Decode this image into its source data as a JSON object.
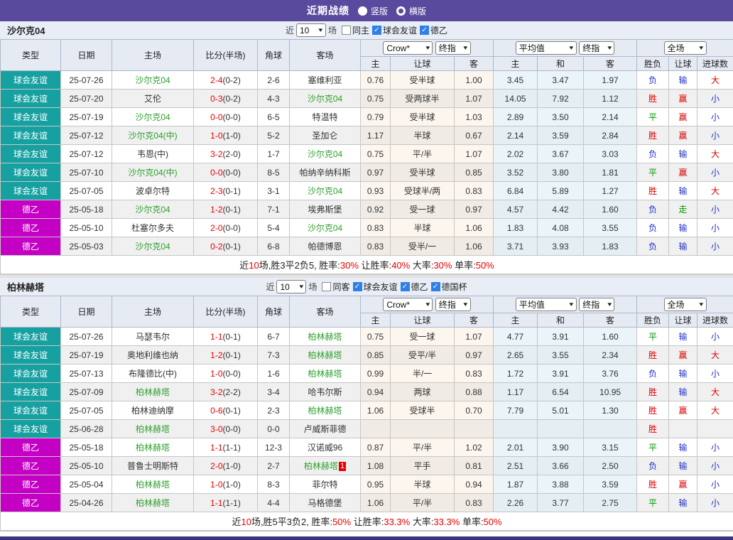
{
  "top": {
    "title": "近期战绩",
    "radio_vertical": "竖版",
    "radio_horizontal": "横版"
  },
  "controls": {
    "near": "近",
    "rounds": "10",
    "games": "场"
  },
  "selects": {
    "odds_source": "Crow*",
    "odds_time": "终指",
    "avg_source": "平均值",
    "avg_time": "终指",
    "scope": "全场"
  },
  "columns": {
    "type": "类型",
    "date": "日期",
    "home": "主场",
    "score": "比分(半场)",
    "corner": "角球",
    "away": "客场",
    "h": "主",
    "hcap": "让球",
    "a": "客",
    "avg_h": "主",
    "avg_d": "和",
    "avg_a": "客",
    "wdl": "胜负",
    "hcap_res": "让球",
    "goals": "进球数"
  },
  "result_colors": {
    "胜": "red",
    "平": "green",
    "负": "blue",
    "赢": "red",
    "输": "blue",
    "走": "green",
    "大": "red",
    "小": "blue"
  },
  "league_colors": {
    "球会友谊": "teal",
    "德乙": "magenta"
  },
  "sections": [
    {
      "team": "沙尔克04",
      "filters": [
        {
          "label": "同主",
          "checked": false
        },
        {
          "label": "球会友谊",
          "checked": true
        },
        {
          "label": "德乙",
          "checked": true
        }
      ],
      "rows": [
        {
          "league": "球会友谊",
          "date": "25-07-26",
          "home": "沙尔克04",
          "home_self": true,
          "score": "2-4",
          "half": "(0-2)",
          "corner": "2-6",
          "away": "塞维利亚",
          "away_self": false,
          "away_badge": "",
          "odds": [
            "0.76",
            "受半球",
            "1.00"
          ],
          "avg": [
            "3.45",
            "3.47",
            "1.97"
          ],
          "res": [
            "负",
            "输",
            "大"
          ]
        },
        {
          "league": "球会友谊",
          "date": "25-07-20",
          "home": "艾伦",
          "home_self": false,
          "score": "0-3",
          "half": "(0-2)",
          "corner": "4-3",
          "away": "沙尔克04",
          "away_self": true,
          "away_badge": "",
          "odds": [
            "0.75",
            "受两球半",
            "1.07"
          ],
          "avg": [
            "14.05",
            "7.92",
            "1.12"
          ],
          "res": [
            "胜",
            "赢",
            "小"
          ]
        },
        {
          "league": "球会友谊",
          "date": "25-07-19",
          "home": "沙尔克04",
          "home_self": true,
          "score": "0-0",
          "half": "(0-0)",
          "corner": "6-5",
          "away": "特温特",
          "away_self": false,
          "away_badge": "",
          "odds": [
            "0.79",
            "受半球",
            "1.03"
          ],
          "avg": [
            "2.89",
            "3.50",
            "2.14"
          ],
          "res": [
            "平",
            "赢",
            "小"
          ]
        },
        {
          "league": "球会友谊",
          "date": "25-07-12",
          "home": "沙尔克04(中)",
          "home_self": true,
          "score": "1-0",
          "half": "(1-0)",
          "corner": "5-2",
          "away": "圣加仑",
          "away_self": false,
          "away_badge": "",
          "odds": [
            "1.17",
            "半球",
            "0.67"
          ],
          "avg": [
            "2.14",
            "3.59",
            "2.84"
          ],
          "res": [
            "胜",
            "赢",
            "小"
          ]
        },
        {
          "league": "球会友谊",
          "date": "25-07-12",
          "home": "韦恩(中)",
          "home_self": false,
          "score": "3-2",
          "half": "(2-0)",
          "corner": "1-7",
          "away": "沙尔克04",
          "away_self": true,
          "away_badge": "",
          "odds": [
            "0.75",
            "平/半",
            "1.07"
          ],
          "avg": [
            "2.02",
            "3.67",
            "3.03"
          ],
          "res": [
            "负",
            "输",
            "大"
          ]
        },
        {
          "league": "球会友谊",
          "date": "25-07-10",
          "home": "沙尔克04(中)",
          "home_self": true,
          "score": "0-0",
          "half": "(0-0)",
          "corner": "8-5",
          "away": "帕纳辛纳科斯",
          "away_self": false,
          "away_badge": "",
          "odds": [
            "0.97",
            "受半球",
            "0.85"
          ],
          "avg": [
            "3.52",
            "3.80",
            "1.81"
          ],
          "res": [
            "平",
            "赢",
            "小"
          ]
        },
        {
          "league": "球会友谊",
          "date": "25-07-05",
          "home": "波卓尔特",
          "home_self": false,
          "score": "2-3",
          "half": "(0-1)",
          "corner": "3-1",
          "away": "沙尔克04",
          "away_self": true,
          "away_badge": "",
          "odds": [
            "0.93",
            "受球半/两",
            "0.83"
          ],
          "avg": [
            "6.84",
            "5.89",
            "1.27"
          ],
          "res": [
            "胜",
            "输",
            "大"
          ]
        },
        {
          "league": "德乙",
          "date": "25-05-18",
          "home": "沙尔克04",
          "home_self": true,
          "score": "1-2",
          "half": "(0-1)",
          "corner": "7-1",
          "away": "埃弗斯堡",
          "away_self": false,
          "away_badge": "",
          "odds": [
            "0.92",
            "受一球",
            "0.97"
          ],
          "avg": [
            "4.57",
            "4.42",
            "1.60"
          ],
          "res": [
            "负",
            "走",
            "小"
          ]
        },
        {
          "league": "德乙",
          "date": "25-05-10",
          "home": "杜塞尔多夫",
          "home_self": false,
          "score": "2-0",
          "half": "(0-0)",
          "corner": "5-4",
          "away": "沙尔克04",
          "away_self": true,
          "away_badge": "",
          "odds": [
            "0.83",
            "半球",
            "1.06"
          ],
          "avg": [
            "1.83",
            "4.08",
            "3.55"
          ],
          "res": [
            "负",
            "输",
            "小"
          ]
        },
        {
          "league": "德乙",
          "date": "25-05-03",
          "home": "沙尔克04",
          "home_self": true,
          "score": "0-2",
          "half": "(0-1)",
          "corner": "6-8",
          "away": "帕德博恩",
          "away_self": false,
          "away_badge": "",
          "odds": [
            "0.83",
            "受半/一",
            "1.06"
          ],
          "avg": [
            "3.71",
            "3.93",
            "1.83"
          ],
          "res": [
            "负",
            "输",
            "小"
          ]
        }
      ],
      "summary_parts": [
        {
          "t": "近"
        },
        {
          "t": "10",
          "red": true
        },
        {
          "t": "场,胜3平2负5, 胜率:"
        },
        {
          "t": "30%",
          "red": true
        },
        {
          "t": " 让胜率:"
        },
        {
          "t": "40%",
          "red": true
        },
        {
          "t": " 大率:"
        },
        {
          "t": "30%",
          "red": true
        },
        {
          "t": " 单率:"
        },
        {
          "t": "50%",
          "red": true
        }
      ]
    },
    {
      "team": "柏林赫塔",
      "filters": [
        {
          "label": "同客",
          "checked": false
        },
        {
          "label": "球会友谊",
          "checked": true
        },
        {
          "label": "德乙",
          "checked": true
        },
        {
          "label": "德国杯",
          "checked": true
        }
      ],
      "rows": [
        {
          "league": "球会友谊",
          "date": "25-07-26",
          "home": "马瑟韦尔",
          "home_self": false,
          "score": "1-1",
          "half": "(0-1)",
          "corner": "6-7",
          "away": "柏林赫塔",
          "away_self": true,
          "away_badge": "",
          "odds": [
            "0.75",
            "受一球",
            "1.07"
          ],
          "avg": [
            "4.77",
            "3.91",
            "1.60"
          ],
          "res": [
            "平",
            "输",
            "小"
          ]
        },
        {
          "league": "球会友谊",
          "date": "25-07-19",
          "home": "奥地利维也纳",
          "home_self": false,
          "score": "1-2",
          "half": "(0-1)",
          "corner": "7-3",
          "away": "柏林赫塔",
          "away_self": true,
          "away_badge": "",
          "odds": [
            "0.85",
            "受平/半",
            "0.97"
          ],
          "avg": [
            "2.65",
            "3.55",
            "2.34"
          ],
          "res": [
            "胜",
            "赢",
            "大"
          ]
        },
        {
          "league": "球会友谊",
          "date": "25-07-13",
          "home": "布隆德比(中)",
          "home_self": false,
          "score": "1-0",
          "half": "(0-0)",
          "corner": "1-6",
          "away": "柏林赫塔",
          "away_self": true,
          "away_badge": "",
          "odds": [
            "0.99",
            "半/一",
            "0.83"
          ],
          "avg": [
            "1.72",
            "3.91",
            "3.76"
          ],
          "res": [
            "负",
            "输",
            "小"
          ]
        },
        {
          "league": "球会友谊",
          "date": "25-07-09",
          "home": "柏林赫塔",
          "home_self": true,
          "score": "3-2",
          "half": "(2-2)",
          "corner": "3-4",
          "away": "哈韦尔斯",
          "away_self": false,
          "away_badge": "",
          "odds": [
            "0.94",
            "两球",
            "0.88"
          ],
          "avg": [
            "1.17",
            "6.54",
            "10.95"
          ],
          "res": [
            "胜",
            "输",
            "大"
          ]
        },
        {
          "league": "球会友谊",
          "date": "25-07-05",
          "home": "柏林迪纳摩",
          "home_self": false,
          "score": "0-6",
          "half": "(0-1)",
          "corner": "2-3",
          "away": "柏林赫塔",
          "away_self": true,
          "away_badge": "",
          "odds": [
            "1.06",
            "受球半",
            "0.70"
          ],
          "avg": [
            "7.79",
            "5.01",
            "1.30"
          ],
          "res": [
            "胜",
            "赢",
            "大"
          ]
        },
        {
          "league": "球会友谊",
          "date": "25-06-28",
          "home": "柏林赫塔",
          "home_self": true,
          "score": "3-0",
          "half": "(0-0)",
          "corner": "0-0",
          "away": "卢威斯菲德",
          "away_self": false,
          "away_badge": "",
          "odds": [
            "",
            "",
            ""
          ],
          "avg": [
            "",
            "",
            ""
          ],
          "res": [
            "胜",
            "",
            ""
          ]
        },
        {
          "league": "德乙",
          "date": "25-05-18",
          "home": "柏林赫塔",
          "home_self": true,
          "score": "1-1",
          "half": "(1-1)",
          "corner": "12-3",
          "away": "汉诺威96",
          "away_self": false,
          "away_badge": "",
          "odds": [
            "0.87",
            "平/半",
            "1.02"
          ],
          "avg": [
            "2.01",
            "3.90",
            "3.15"
          ],
          "res": [
            "平",
            "输",
            "小"
          ]
        },
        {
          "league": "德乙",
          "date": "25-05-10",
          "home": "普鲁士明斯特",
          "home_self": false,
          "score": "2-0",
          "half": "(1-0)",
          "corner": "2-7",
          "away": "柏林赫塔",
          "away_self": true,
          "away_badge": "1",
          "odds": [
            "1.08",
            "平手",
            "0.81"
          ],
          "avg": [
            "2.51",
            "3.66",
            "2.50"
          ],
          "res": [
            "负",
            "输",
            "小"
          ]
        },
        {
          "league": "德乙",
          "date": "25-05-04",
          "home": "柏林赫塔",
          "home_self": true,
          "score": "1-0",
          "half": "(1-0)",
          "corner": "8-3",
          "away": "菲尔特",
          "away_self": false,
          "away_badge": "",
          "odds": [
            "0.95",
            "半球",
            "0.94"
          ],
          "avg": [
            "1.87",
            "3.88",
            "3.59"
          ],
          "res": [
            "胜",
            "赢",
            "小"
          ]
        },
        {
          "league": "德乙",
          "date": "25-04-26",
          "home": "柏林赫塔",
          "home_self": true,
          "score": "1-1",
          "half": "(1-1)",
          "corner": "4-4",
          "away": "马格德堡",
          "away_self": false,
          "away_badge": "",
          "odds": [
            "1.06",
            "平/半",
            "0.83"
          ],
          "avg": [
            "2.26",
            "3.77",
            "2.75"
          ],
          "res": [
            "平",
            "输",
            "小"
          ]
        }
      ],
      "summary_parts": [
        {
          "t": "近"
        },
        {
          "t": "10",
          "red": true
        },
        {
          "t": "场,胜5平3负2, 胜率:"
        },
        {
          "t": "50%",
          "red": true
        },
        {
          "t": " 让胜率:"
        },
        {
          "t": "33.3%",
          "red": true
        },
        {
          "t": " 大率:"
        },
        {
          "t": "33.3%",
          "red": true
        },
        {
          "t": " 单率:"
        },
        {
          "t": "50%",
          "red": true
        }
      ]
    }
  ]
}
